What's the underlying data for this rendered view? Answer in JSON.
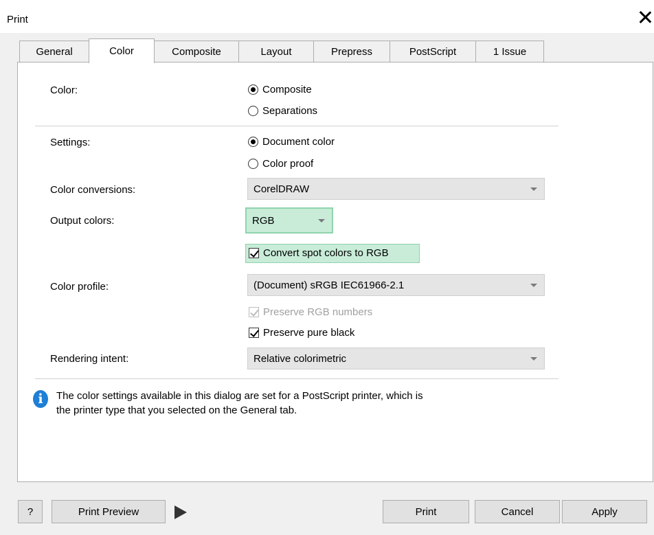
{
  "window": {
    "title": "Print"
  },
  "tabs": [
    "General",
    "Color",
    "Composite",
    "Layout",
    "Prepress",
    "PostScript",
    "1 Issue"
  ],
  "color_section": {
    "label": "Color:",
    "options": [
      {
        "label": "Composite",
        "selected": true
      },
      {
        "label": "Separations",
        "selected": false
      }
    ]
  },
  "settings_section": {
    "label": "Settings:",
    "options": [
      {
        "label": "Document color",
        "selected": true
      },
      {
        "label": "Color proof",
        "selected": false
      }
    ]
  },
  "color_conversions": {
    "label": "Color conversions:",
    "value": "CorelDRAW"
  },
  "output_colors": {
    "label": "Output colors:",
    "value": "RGB"
  },
  "convert_spot": {
    "label": "Convert spot colors to RGB",
    "checked": true
  },
  "color_profile": {
    "label": "Color profile:",
    "value": "(Document) sRGB IEC61966-2.1"
  },
  "preserve_rgb": {
    "label": "Preserve RGB numbers",
    "checked": true,
    "disabled": true
  },
  "preserve_black": {
    "label": "Preserve pure black",
    "checked": true
  },
  "rendering_intent": {
    "label": "Rendering intent:",
    "value": "Relative colorimetric"
  },
  "info": {
    "line1": "The color settings available in this dialog are set for a PostScript printer, which is",
    "line2": "the printer type that you selected on the General tab."
  },
  "buttons": {
    "help": "?",
    "print_preview": "Print Preview",
    "print": "Print",
    "cancel": "Cancel",
    "apply": "Apply"
  },
  "colors": {
    "highlight": "#c8ecd8",
    "highlight_border": "#8fd3ad",
    "info_icon": "#1e7fd6"
  }
}
